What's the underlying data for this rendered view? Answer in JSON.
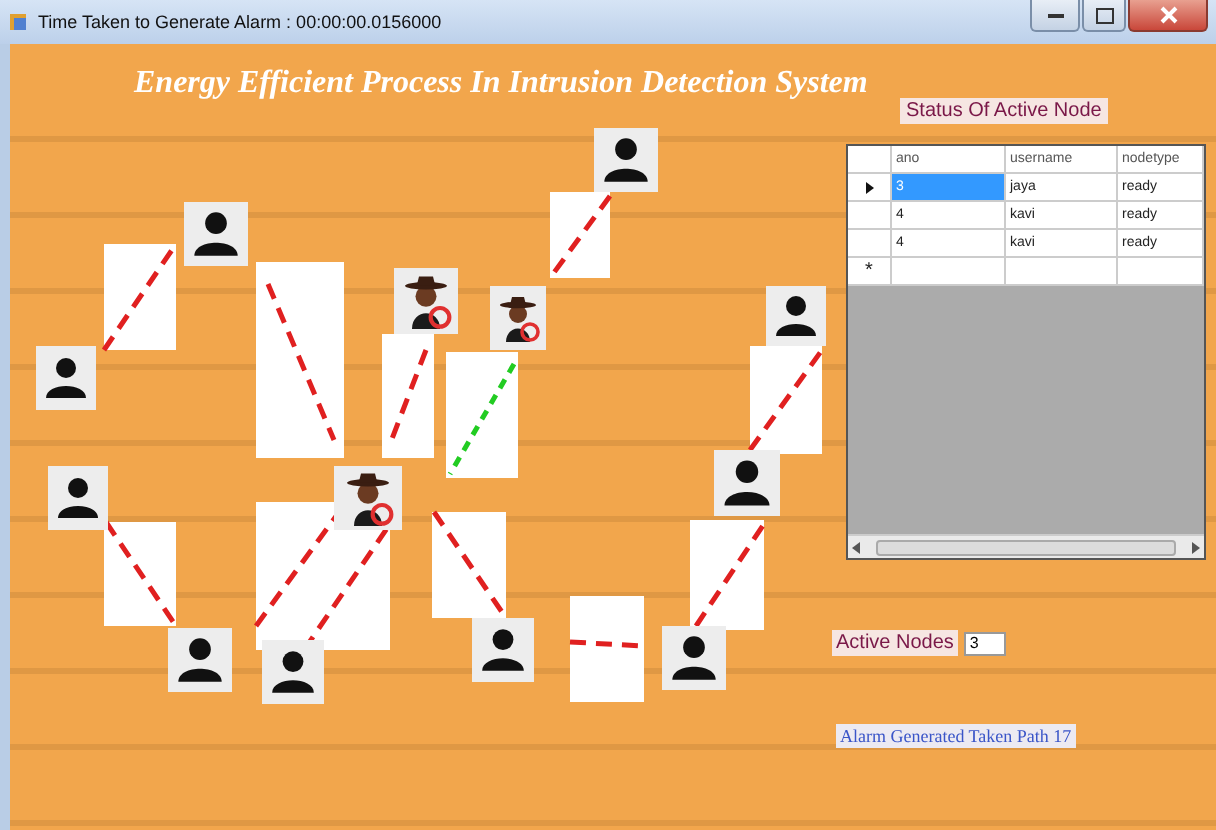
{
  "window": {
    "title": "Time Taken to Generate Alarm : 00:00:00.0156000"
  },
  "heading": "Energy Efficient Process  In Intrusion Detection System",
  "status_label": "Status Of Active Node",
  "table": {
    "columns": [
      "ano",
      "username",
      "nodetype"
    ],
    "rows": [
      {
        "ano": "3",
        "username": "jaya",
        "nodetype": "ready",
        "selected": true
      },
      {
        "ano": "4",
        "username": "kavi",
        "nodetype": "ready",
        "selected": false
      },
      {
        "ano": "4",
        "username": "kavi",
        "nodetype": "ready",
        "selected": false
      }
    ],
    "new_row_marker": "*"
  },
  "nodes": [
    {
      "kind": "person"
    },
    {
      "kind": "person"
    },
    {
      "kind": "person"
    },
    {
      "kind": "person"
    },
    {
      "kind": "person"
    },
    {
      "kind": "person"
    },
    {
      "kind": "intruder"
    },
    {
      "kind": "intruder"
    },
    {
      "kind": "intruder"
    },
    {
      "kind": "person"
    },
    {
      "kind": "person"
    },
    {
      "kind": "person"
    },
    {
      "kind": "person"
    }
  ],
  "links": [
    {
      "color": "#e02020"
    },
    {
      "color": "#e02020"
    },
    {
      "color": "#e02020"
    },
    {
      "color": "#22cc22"
    },
    {
      "color": "#e02020"
    },
    {
      "color": "#e02020"
    },
    {
      "color": "#e02020"
    },
    {
      "color": "#e02020"
    },
    {
      "color": "#e02020"
    },
    {
      "color": "#e02020"
    },
    {
      "color": "#e02020"
    },
    {
      "color": "#e02020"
    }
  ],
  "active_nodes": {
    "label": "Active Nodes",
    "value": "3"
  },
  "alarm": "Alarm Generated Taken Path 17"
}
